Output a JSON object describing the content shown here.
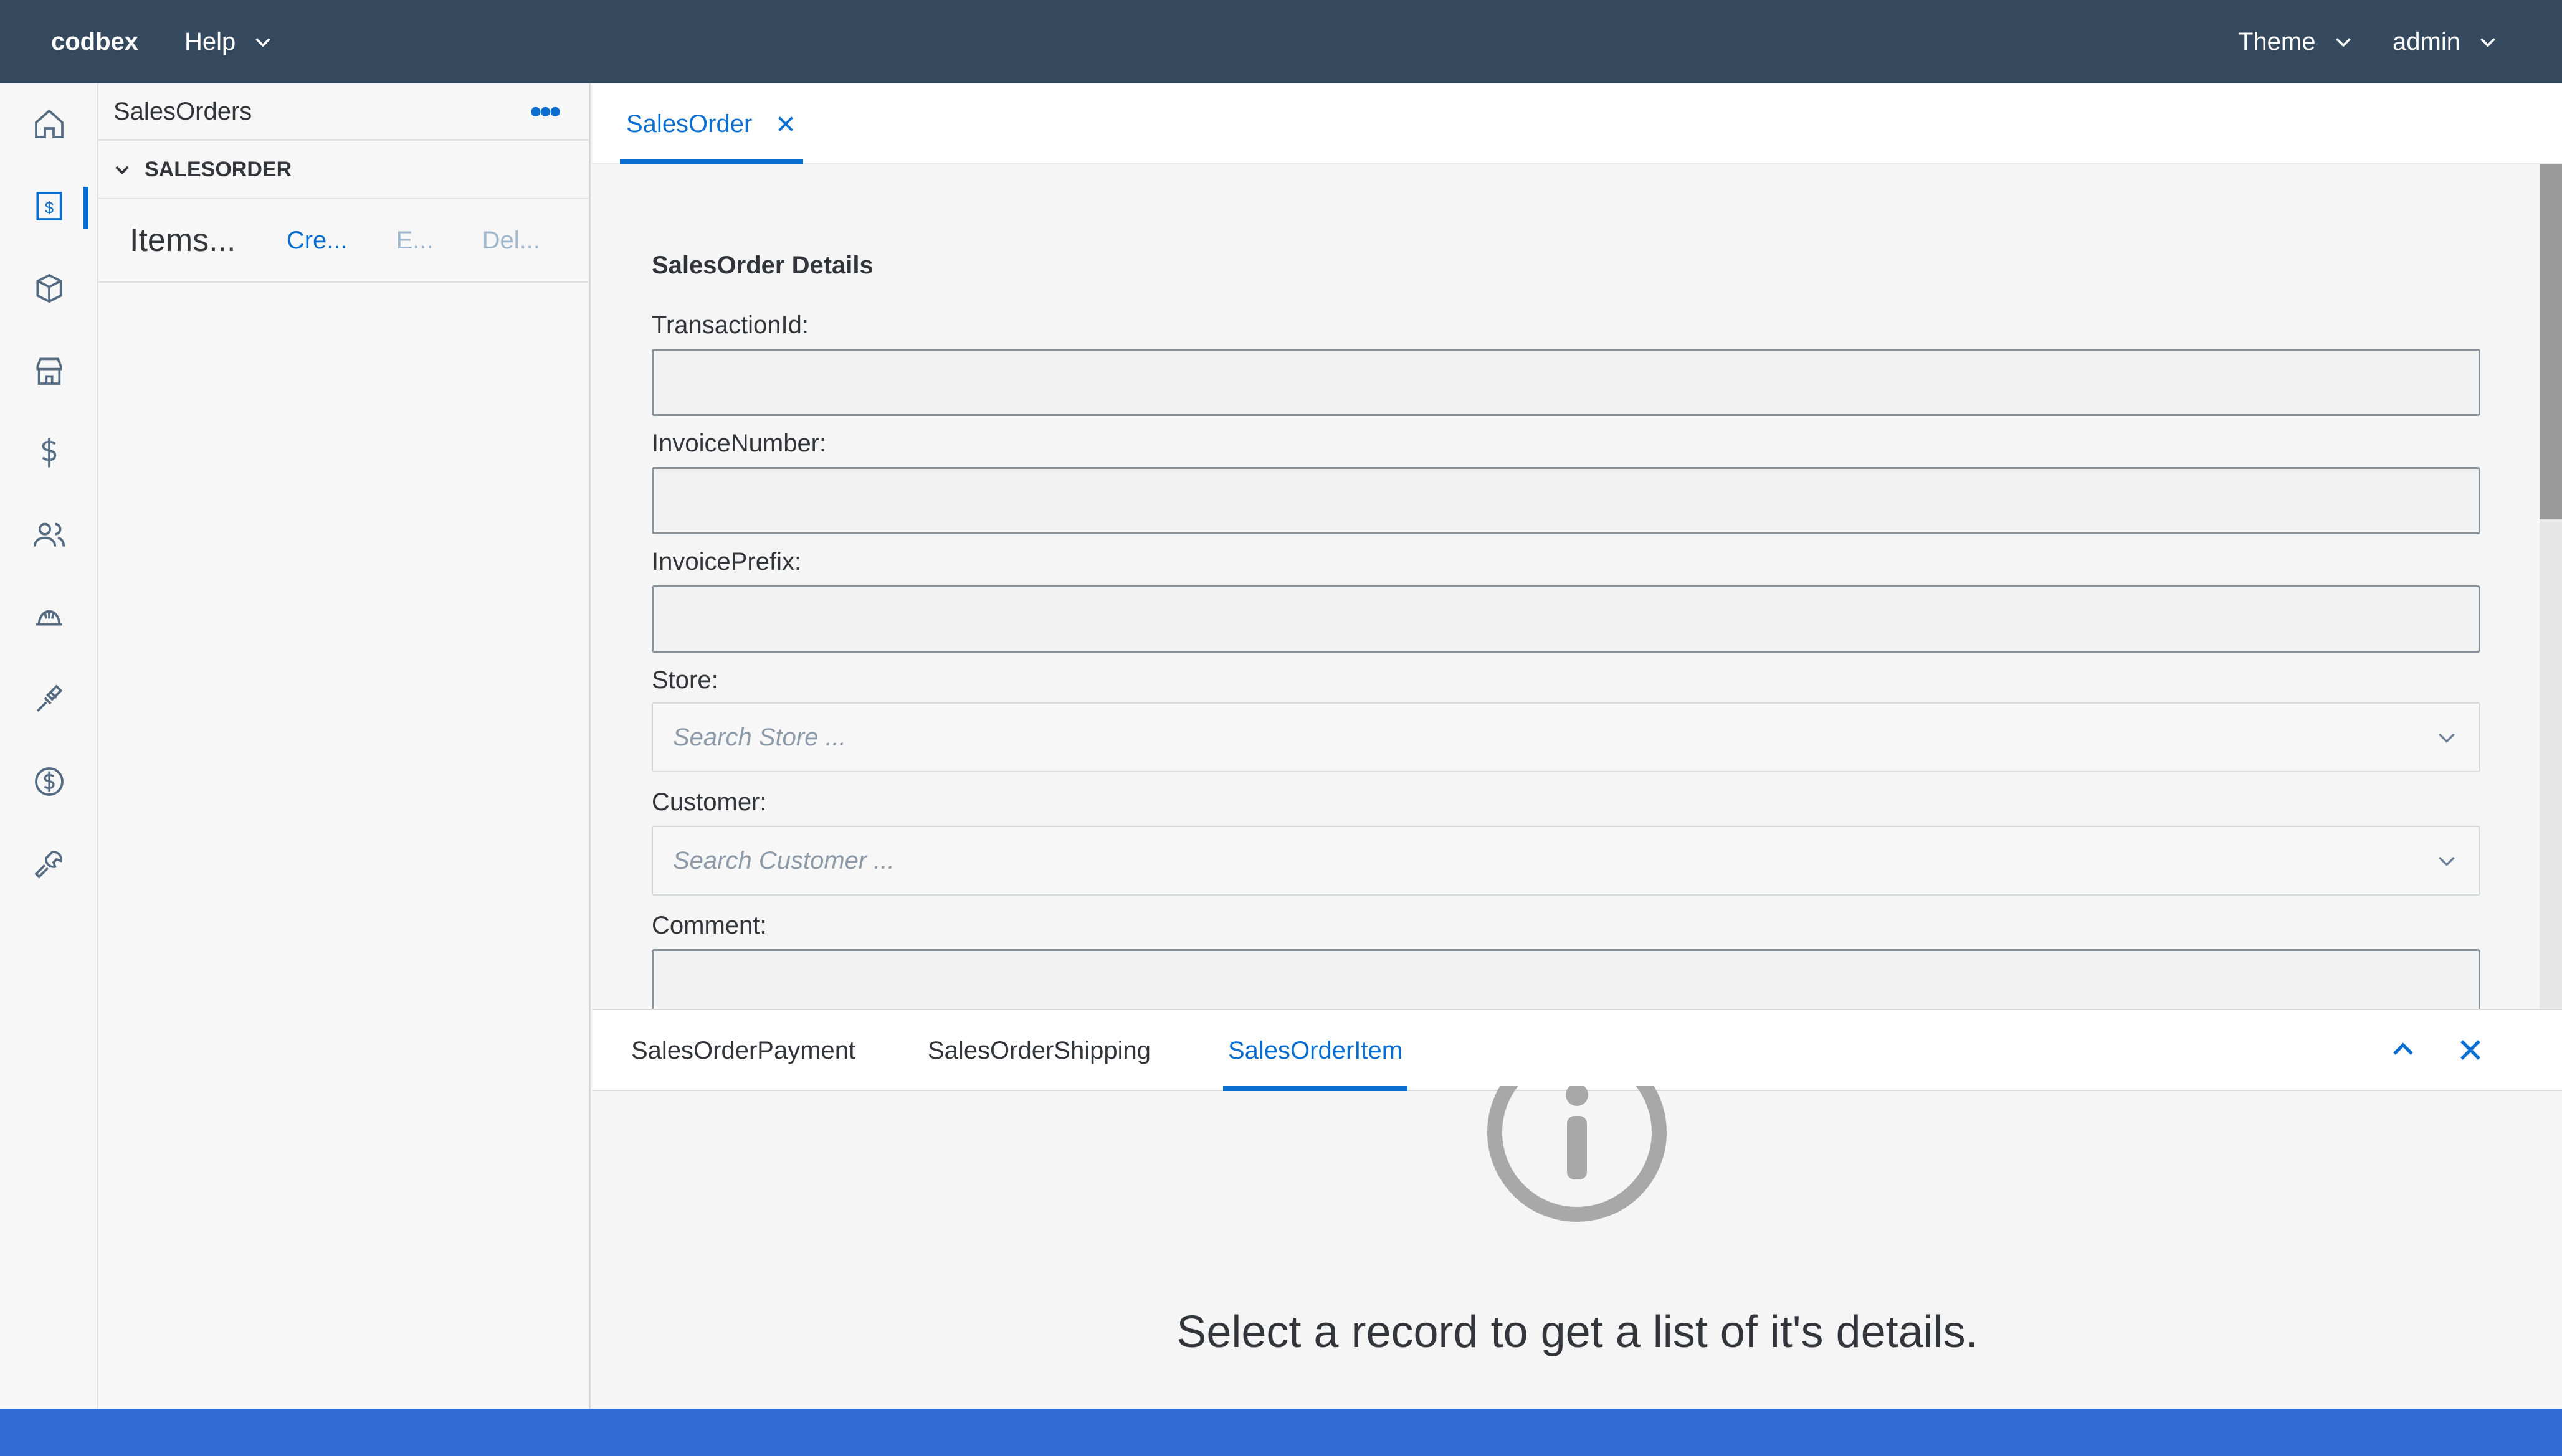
{
  "shell": {
    "brand": "codbex",
    "help_label": "Help",
    "theme_label": "Theme",
    "user_label": "admin"
  },
  "sidenav": {
    "items": [
      {
        "icon": "home-icon"
      },
      {
        "icon": "sales-document-icon",
        "active": true
      },
      {
        "icon": "product-box-icon"
      },
      {
        "icon": "store-icon"
      },
      {
        "icon": "dollar-icon"
      },
      {
        "icon": "people-icon"
      },
      {
        "icon": "helmet-icon"
      },
      {
        "icon": "wrench-screw-icon"
      },
      {
        "icon": "dollar-circle-icon"
      },
      {
        "icon": "settings-wrench-icon"
      }
    ]
  },
  "tree": {
    "title": "SalesOrders",
    "more_label": "•••",
    "group": "SALESORDER",
    "row": {
      "title": "Items...",
      "create": "Cre...",
      "edit": "E...",
      "delete": "Del..."
    }
  },
  "main": {
    "tab_label": "SalesOrder",
    "section_title": "SalesOrder Details",
    "fields": {
      "transaction_id": "TransactionId:",
      "invoice_number": "InvoiceNumber:",
      "invoice_prefix": "InvoicePrefix:",
      "store": "Store:",
      "store_placeholder": "Search Store ...",
      "customer": "Customer:",
      "customer_placeholder": "Search Customer ...",
      "comment": "Comment:"
    }
  },
  "details": {
    "tabs": [
      "SalesOrderPayment",
      "SalesOrderShipping",
      "SalesOrderItem"
    ],
    "active_tab": "SalesOrderItem",
    "empty_message": "Select a record to get a list of it's details."
  },
  "colors": {
    "shell": "#354a5f",
    "accent": "#0a6ed1",
    "footer": "#2f6bd1"
  }
}
